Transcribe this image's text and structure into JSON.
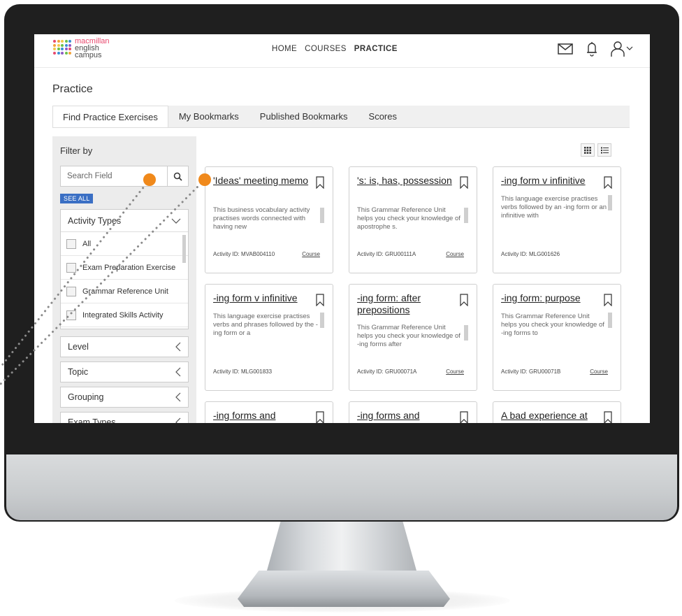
{
  "logo": {
    "line1": "macmillan",
    "line2": "english",
    "line3": "campus"
  },
  "nav": {
    "home": "HOME",
    "courses": "COURSES",
    "practice": "PRACTICE"
  },
  "page_title": "Practice",
  "tabs": [
    "Find Practice Exercises",
    "My Bookmarks",
    "Published Bookmarks",
    "Scores"
  ],
  "filter": {
    "title": "Filter by",
    "search_placeholder": "Search Field",
    "see_all": "SEE ALL",
    "activity_types": {
      "label": "Activity Types",
      "items": [
        "All",
        "Exam Preparation Exercise",
        "Grammar Reference Unit",
        "Integrated Skills Activity"
      ]
    },
    "sections": [
      "Level",
      "Topic",
      "Grouping",
      "Exam Types"
    ]
  },
  "cards": [
    {
      "title": "'Ideas' meeting memo",
      "desc": "This business vocabulary activity practises words connected with having new",
      "id": "Activity ID: MVAB004110",
      "link": "Course"
    },
    {
      "title": "'s: is, has, possession",
      "desc": "This Grammar Reference Unit helps you check your knowledge of apostrophe s.",
      "id": "Activity ID: GRU00111A",
      "link": "Course"
    },
    {
      "title": "-ing form v infinitive",
      "desc": "This language exercise practises verbs followed by an -ing form or an infinitive with",
      "id": "Activity ID: MLG001626",
      "link": ""
    },
    {
      "title": "-ing form v infinitive",
      "desc": "This language exercise practises verbs and phrases followed by the -ing form or a",
      "id": "Activity ID: MLG001833",
      "link": ""
    },
    {
      "title": "-ing form: after prepositions",
      "desc": "This Grammar Reference Unit helps you check your knowledge of -ing forms after",
      "id": "Activity ID: GRU00071A",
      "link": "Course"
    },
    {
      "title": "-ing form: purpose",
      "desc": "This Grammar Reference Unit helps you check your knowledge of -ing forms to",
      "id": "Activity ID: GRU00071B",
      "link": "Course"
    },
    {
      "title": "-ing forms and",
      "desc": "",
      "id": "",
      "link": ""
    },
    {
      "title": "-ing forms and",
      "desc": "",
      "id": "",
      "link": ""
    },
    {
      "title": "A bad experience at",
      "desc": "",
      "id": "",
      "link": ""
    }
  ],
  "colors": {
    "accent_blue": "#3a6fc4",
    "callout_orange": "#f0891b",
    "bezel": "#1f1f1f"
  },
  "icons": [
    "mail-icon",
    "bell-icon",
    "user-icon",
    "search-icon",
    "grid-view-icon",
    "list-view-icon",
    "bookmark-icon",
    "chevron-down-icon",
    "chevron-left-icon"
  ]
}
